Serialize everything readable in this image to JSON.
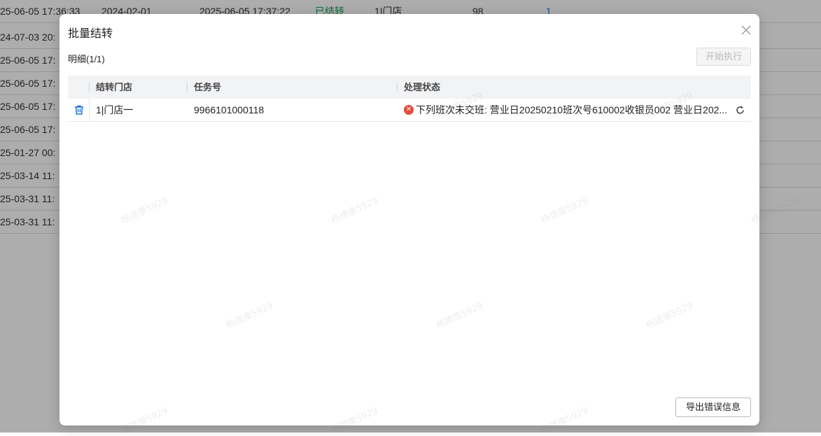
{
  "background_table": {
    "rows": [
      {
        "c1": "25-06-05 17:36:33",
        "c2": "2024-02-01",
        "c3": "2025-06-05 17:37:22",
        "c4": "已结转",
        "c5": "1|门店",
        "c6": "98",
        "c7": "1"
      },
      {
        "c1": "24-07-03 20:"
      },
      {
        "c1": "25-06-05 17:"
      },
      {
        "c1": "25-06-05 17:"
      },
      {
        "c1": "25-06-05 17:"
      },
      {
        "c1": "25-06-05 17:"
      },
      {
        "c1": "25-01-27 00:"
      },
      {
        "c1": "25-03-14 11:"
      },
      {
        "c1": "25-03-31 11:"
      },
      {
        "c1": "25-03-31 11:"
      }
    ]
  },
  "watermark": "杨建康5929",
  "dialog": {
    "title": "批量结转",
    "detail_label": "明细(1/1)",
    "start_button": "开始执行",
    "export_button": "导出错误信息",
    "columns": [
      "结转门店",
      "任务号",
      "处理状态"
    ],
    "rows": [
      {
        "store": "1|门店一",
        "task_no": "9966101000118",
        "status": "下列班次未交班: 营业日20250210班次号610002收银员002 营业日202..."
      }
    ]
  },
  "colors": {
    "error": "#e34d3a",
    "link_blue": "#1a6fd6",
    "success_green": "#12a05c"
  }
}
